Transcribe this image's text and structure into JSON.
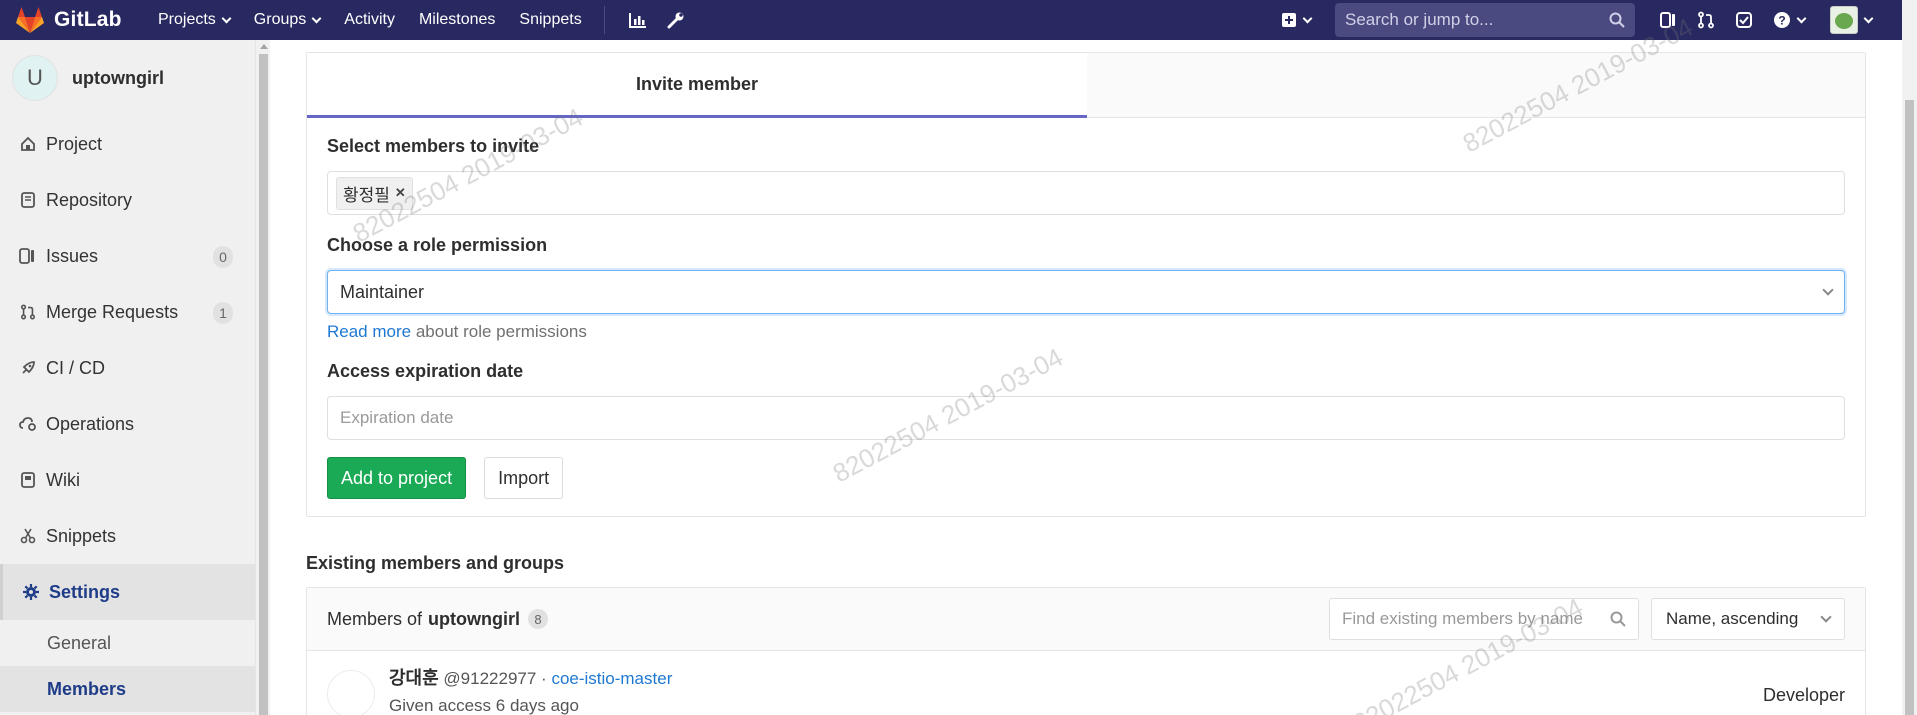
{
  "navbar": {
    "brand": "GitLab",
    "links": [
      {
        "label": "Projects",
        "dropdown": true
      },
      {
        "label": "Groups",
        "dropdown": true
      },
      {
        "label": "Activity",
        "dropdown": false
      },
      {
        "label": "Milestones",
        "dropdown": false
      },
      {
        "label": "Snippets",
        "dropdown": false
      }
    ],
    "search_placeholder": "Search or jump to...",
    "icons": [
      "chart-icon",
      "wrench-icon",
      "plus-square-icon",
      "issues-icon",
      "merge-request-icon",
      "todo-check-icon",
      "help-icon",
      "user-avatar"
    ],
    "bg_color": "#292961"
  },
  "sidebar": {
    "avatar_letter": "U",
    "project_name": "uptowngirl",
    "items": [
      {
        "label": "Project",
        "icon": "home-icon"
      },
      {
        "label": "Repository",
        "icon": "doc-icon"
      },
      {
        "label": "Issues",
        "icon": "issues-icon",
        "count": "0"
      },
      {
        "label": "Merge Requests",
        "icon": "merge-request-icon",
        "count": "1"
      },
      {
        "label": "CI / CD",
        "icon": "rocket-icon"
      },
      {
        "label": "Operations",
        "icon": "cloud-gear-icon"
      },
      {
        "label": "Wiki",
        "icon": "book-icon"
      },
      {
        "label": "Snippets",
        "icon": "scissors-icon"
      },
      {
        "label": "Settings",
        "icon": "gear-icon",
        "active": true
      }
    ],
    "subitems": [
      {
        "label": "General"
      },
      {
        "label": "Members",
        "active": true
      }
    ]
  },
  "invite": {
    "tab_label": "Invite member",
    "select_label": "Select members to invite",
    "selected_token": "황정필",
    "role_label": "Choose a role permission",
    "role_value": "Maintainer",
    "help_link": "Read more",
    "help_text": " about role permissions",
    "expiration_label": "Access expiration date",
    "expiration_placeholder": "Expiration date",
    "add_button": "Add to project",
    "import_button": "Import"
  },
  "members": {
    "section_title": "Existing members and groups",
    "header_prefix": "Members of",
    "project": "uptowngirl",
    "count": "8",
    "search_placeholder": "Find existing members by name",
    "sort_value": "Name, ascending",
    "rows": [
      {
        "name": "강대훈",
        "username": "@91222977",
        "separator": " · ",
        "group": "coe-istio-master",
        "access": "Given access 6 days ago",
        "role": "Developer"
      }
    ]
  },
  "watermark": {
    "text": "82022504  2019-03-04"
  },
  "colors": {
    "accent_blue": "#1f78d1",
    "success_green": "#1aaa55",
    "tab_underline": "#6666c4"
  }
}
